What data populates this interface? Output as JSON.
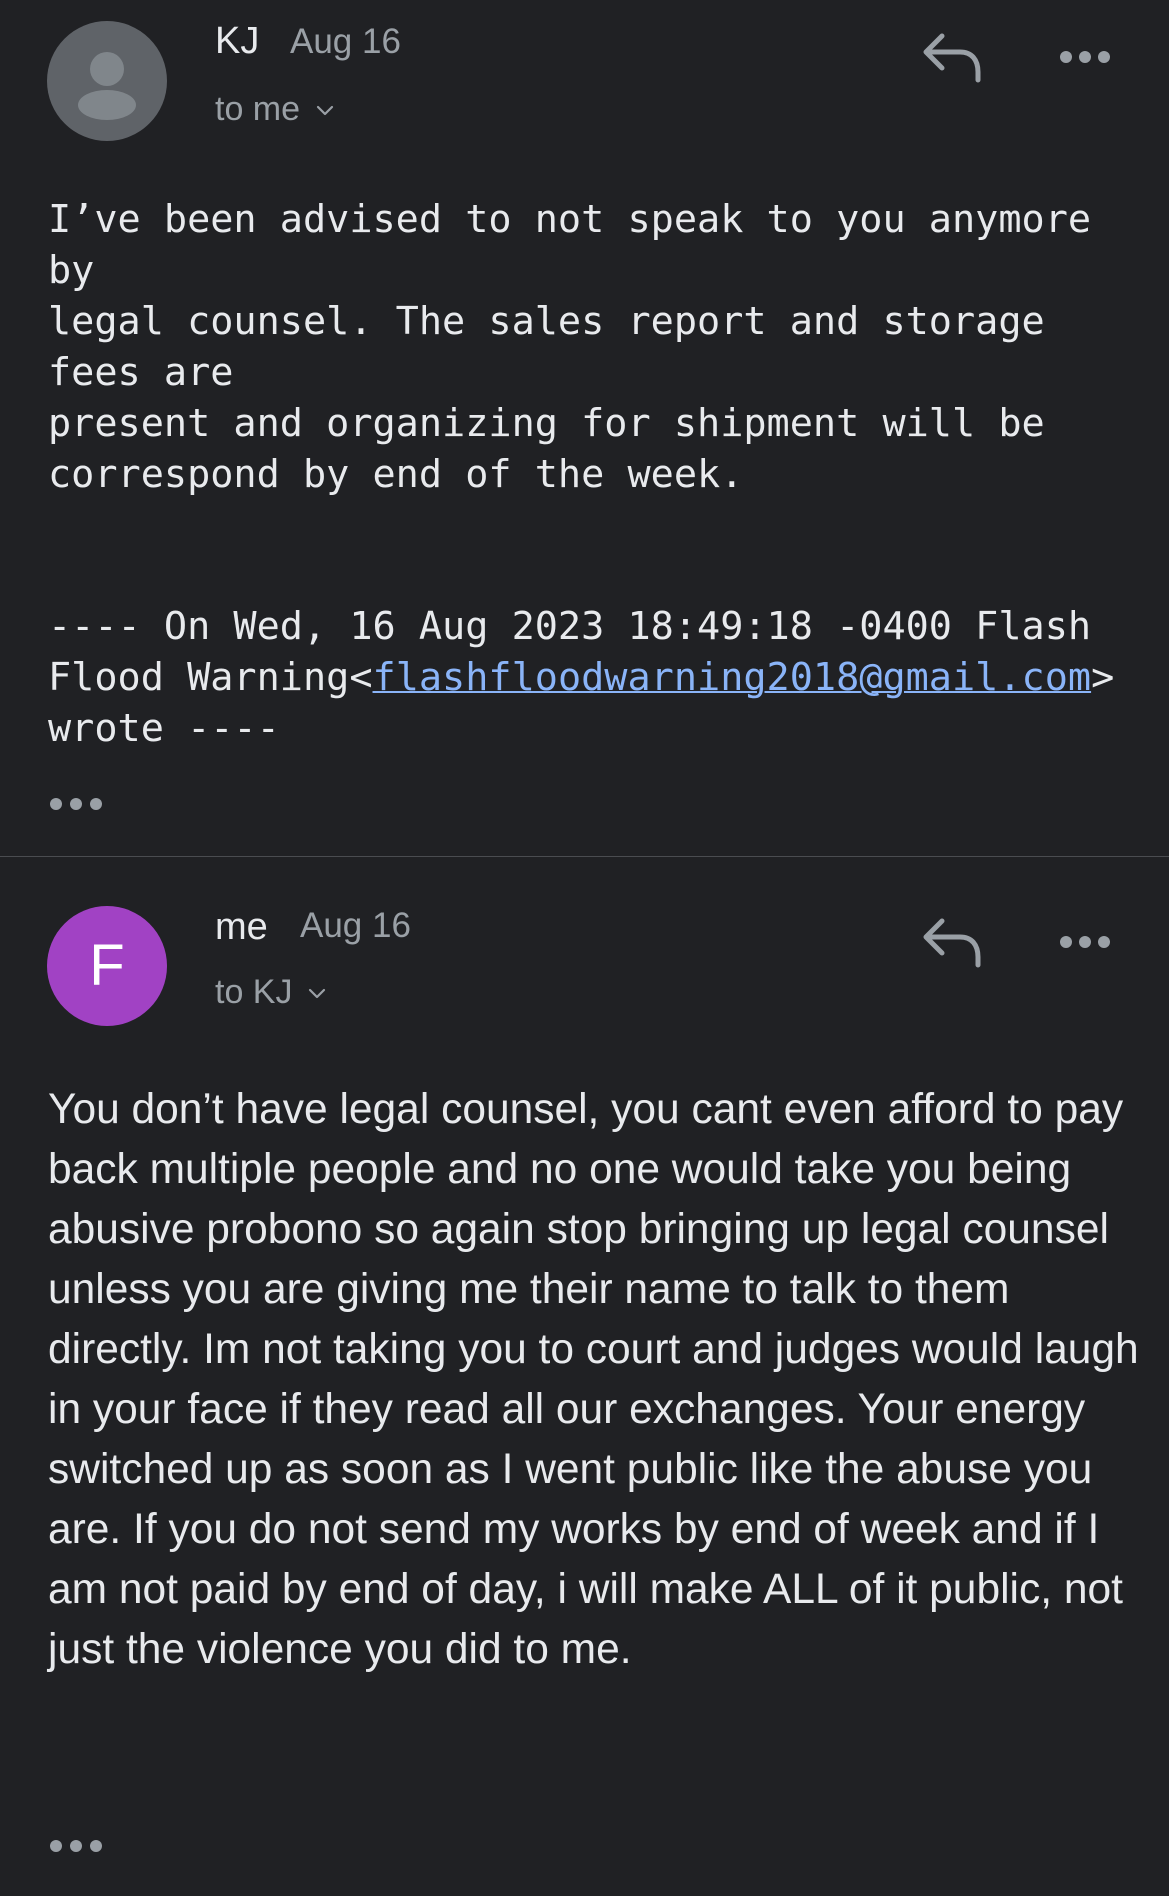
{
  "messages": [
    {
      "sender": "KJ",
      "date": "Aug 16",
      "recipient": "to me",
      "avatar": {
        "type": "person-icon",
        "color": "#5f6368"
      },
      "body": "I’ve been advised to not speak to you anymore by\nlegal counsel. The sales report and storage fees are\npresent and organizing for shipment will be\ncorrespond by end of the week.",
      "quote": {
        "prefix": "---- On Wed, 16 Aug 2023 18:49:18 -0400 Flash Flood Warning<",
        "email": "flashfloodwarning2018@gmail.com",
        "suffix": "> wrote ----"
      }
    },
    {
      "sender": "me",
      "date": "Aug 16",
      "recipient": "to KJ",
      "avatar": {
        "letter": "F",
        "color": "#a142c4"
      },
      "body": "You don’t have legal counsel, you cant even afford to pay back multiple people and no one would take you being abusive probono so again stop bringing up legal counsel unless you are giving me their name to talk to them directly. Im not taking you to court and judges would laugh in your face if they read all our exchanges. Your energy switched up as soon as I went public like the abuse you are. If you do not send my works by end of week and if I am not paid by end of day, i will make ALL of it public, not just the violence you did to me."
    }
  ],
  "icons": {
    "reply": "reply-icon",
    "more": "more-options-icon",
    "expand": "show-trimmed-content-icon",
    "chevron": "chevron-down-icon"
  },
  "colors": {
    "background": "#202124",
    "text_primary": "#e8eaed",
    "text_secondary": "#9aa0a6",
    "link": "#8ab4f8",
    "divider": "#4a4c50"
  }
}
